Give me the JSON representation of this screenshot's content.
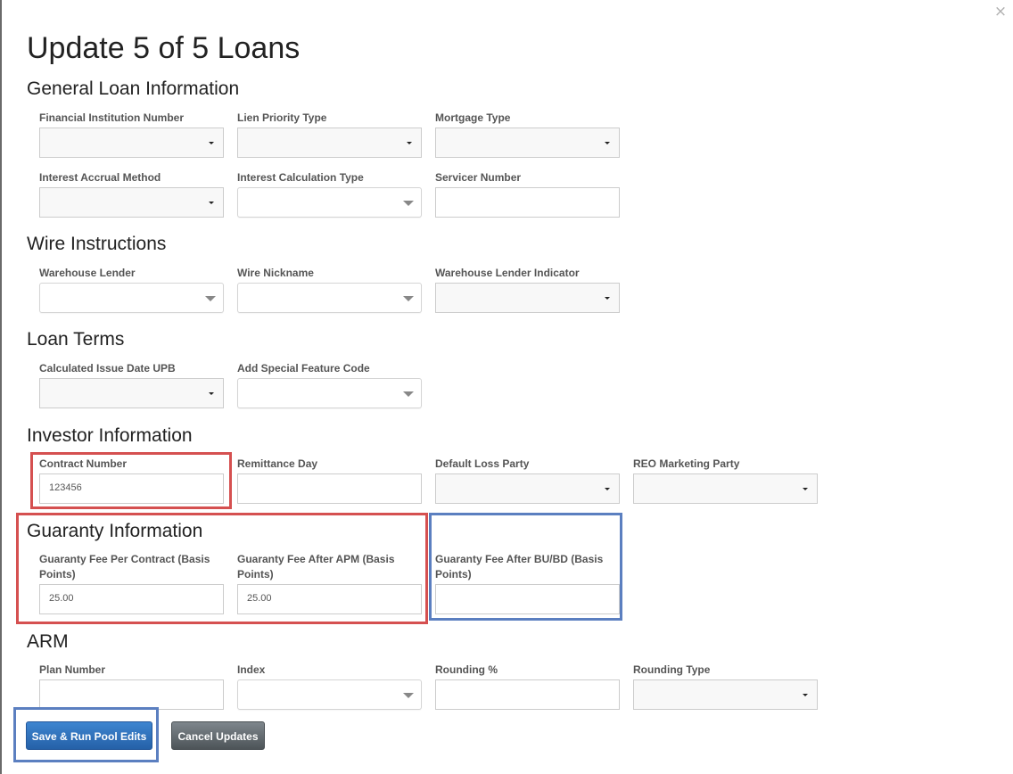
{
  "dialog": {
    "title": "Update 5 of 5 Loans",
    "close_icon": "×"
  },
  "sections": {
    "general": {
      "title": "General Loan Information",
      "fields": {
        "financial_institution_number": {
          "label": "Financial Institution Number",
          "value": ""
        },
        "lien_priority_type": {
          "label": "Lien Priority Type",
          "value": ""
        },
        "mortgage_type": {
          "label": "Mortgage Type",
          "value": ""
        },
        "interest_accrual_method": {
          "label": "Interest Accrual Method",
          "value": ""
        },
        "interest_calculation_type": {
          "label": "Interest Calculation Type",
          "value": ""
        },
        "servicer_number": {
          "label": "Servicer Number",
          "value": ""
        }
      }
    },
    "wire": {
      "title": "Wire Instructions",
      "fields": {
        "warehouse_lender": {
          "label": "Warehouse Lender",
          "value": ""
        },
        "wire_nickname": {
          "label": "Wire Nickname",
          "value": ""
        },
        "warehouse_lender_indicator": {
          "label": "Warehouse Lender Indicator",
          "value": ""
        }
      }
    },
    "loan_terms": {
      "title": "Loan Terms",
      "fields": {
        "calculated_issue_date_upb": {
          "label": "Calculated Issue Date UPB",
          "value": ""
        },
        "add_special_feature_code": {
          "label": "Add Special Feature Code",
          "value": ""
        }
      }
    },
    "investor": {
      "title": "Investor Information",
      "fields": {
        "contract_number": {
          "label": "Contract Number",
          "value": "123456"
        },
        "remittance_day": {
          "label": "Remittance Day",
          "value": ""
        },
        "default_loss_party": {
          "label": "Default Loss Party",
          "value": ""
        },
        "reo_marketing_party": {
          "label": "REO Marketing Party",
          "value": ""
        }
      }
    },
    "guaranty": {
      "title": "Guaranty Information",
      "fields": {
        "fee_per_contract": {
          "label": "Guaranty Fee Per Contract (Basis Points)",
          "value": "25.00"
        },
        "fee_after_apm": {
          "label": "Guaranty Fee After APM (Basis Points)",
          "value": "25.00"
        },
        "fee_after_bubd": {
          "label": "Guaranty Fee After BU/BD (Basis Points)",
          "value": ""
        }
      }
    },
    "arm": {
      "title": "ARM",
      "fields": {
        "plan_number": {
          "label": "Plan Number",
          "value": ""
        },
        "index": {
          "label": "Index",
          "value": ""
        },
        "rounding_percent": {
          "label": "Rounding %",
          "value": ""
        },
        "rounding_type": {
          "label": "Rounding Type",
          "value": ""
        }
      }
    }
  },
  "actions": {
    "save_label": "Save & Run Pool Edits",
    "cancel_label": "Cancel Updates"
  },
  "colors": {
    "highlight_red": "#d55050",
    "highlight_blue": "#5b7fc0",
    "primary_button": "#2f6fbd",
    "secondary_button": "#5f666b"
  }
}
